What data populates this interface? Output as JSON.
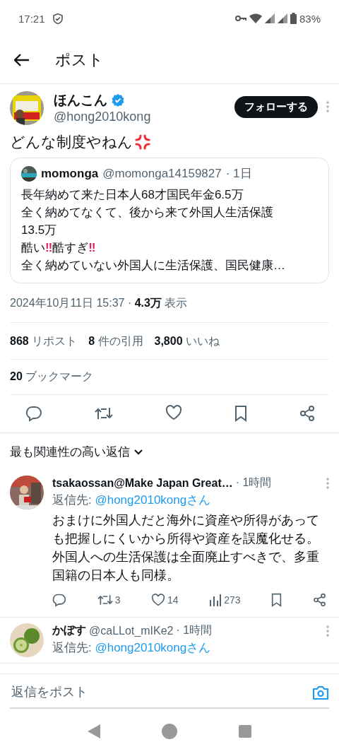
{
  "status_bar": {
    "time": "17:21",
    "battery": "83%"
  },
  "header": {
    "title": "ポスト"
  },
  "post": {
    "author": {
      "name": "ほんこん",
      "handle": "@hong2010kong",
      "verified": true
    },
    "follow_button": "フォローする",
    "text": "どんな制度やねん",
    "quote": {
      "name": "momonga",
      "handle": "@momonga14159827",
      "time": "· 1日",
      "lines": [
        [
          {
            "kind": "plain",
            "text": "長年納めて来た日本人68才国民年金6.5万"
          }
        ],
        [
          {
            "kind": "plain",
            "text": "全く納めてなくて、後から来て外国人生活保護"
          }
        ],
        [
          {
            "kind": "plain",
            "text": "13.5万"
          }
        ],
        [
          {
            "kind": "plain",
            "text": "酷い"
          },
          {
            "kind": "emphasis",
            "text": "‼"
          },
          {
            "kind": "plain",
            "text": "酷すぎ"
          },
          {
            "kind": "emphasis",
            "text": "‼"
          }
        ],
        [
          {
            "kind": "plain",
            "text": "全く納めていない外国人に生活保護、国民健康…"
          }
        ]
      ]
    },
    "meta": "2024年10月11日 15:37 · **4.3万** 表示",
    "stats": [
      "**868** リポスト",
      "**8** 件の引用",
      "**3,800** いいね"
    ],
    "bookmarks": "**20** ブックマーク"
  },
  "sort": {
    "label": "最も関連性の高い返信"
  },
  "replies": [
    {
      "name": "tsakaossan@Make Japan Great…",
      "time": "· 1時間",
      "reply_to_label": "返信先:",
      "reply_to": "@hong2010kongさん",
      "text": "おまけに外国人だと海外に資産や所得があっても把握しにくいから所得や資産を誤魔化せる。外国人への生活保護は全面廃止すべきで、多重国籍の日本人も同様。",
      "reposts": "3",
      "likes": "14",
      "views": "273"
    },
    {
      "name": "かぼす",
      "handle": "@caLLot_mIKe2",
      "time": "· 1時間",
      "reply_to_label": "返信先:",
      "reply_to": "@hong2010kongさん"
    }
  ],
  "reply_bar": {
    "placeholder": "返信をポスト"
  }
}
